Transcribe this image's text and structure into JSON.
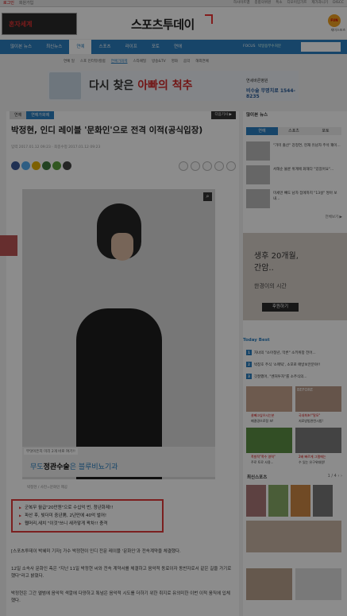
{
  "topbar": {
    "left": [
      "로그인",
      "회원가입"
    ],
    "right": [
      "하사이트맵",
      "종합의위원",
      "특소",
      "디모이임가프",
      "제가과니기",
      "DISCC"
    ]
  },
  "header": {
    "ad_left_text": "혼자세계",
    "logo": "스포츠투데이",
    "fun_badge": "FUN",
    "fun_label": "재미스포츠"
  },
  "nav": {
    "items": [
      "많이본 뉴스",
      "최신뉴스",
      "연예",
      "스포츠",
      "라이프",
      "포토",
      "연애"
    ],
    "active_index": 2,
    "focus": "FOCUS",
    "focus_text": "박일용부수처분"
  },
  "subnav": {
    "items": [
      "연예 일",
      "스포 인터뷰/칼럼",
      "연예가화제",
      "스타패밀",
      "방송&TV",
      "영화",
      "음악",
      "해외연예"
    ],
    "active_index": 2
  },
  "banner": {
    "title_a": "다시 찾은 ",
    "title_b": "아빠의 척추",
    "hospital": "연세바른병원",
    "phone": "비수술 무명치료 1544-8235"
  },
  "article": {
    "tabs": [
      "연예",
      "연예가화제"
    ],
    "more": "다음기사 ▶",
    "title": "박정현, 인디 레이블 '문화인'으로 전격 이적(공식입장)",
    "meta": "입력 2017.01.12 09:23  ·  최종수정 2017.01.12 09:23",
    "share_colors": [
      "#3b5998",
      "#55acee",
      "#e3b000",
      "#3e7b3e",
      "#5a9e3c",
      "#444"
    ],
    "photo_overlay_small": "무엇이든지 미리 2개 바로 여기!!",
    "photo_overlay_big_a": "무도",
    "photo_overlay_big_b": "정관수술",
    "photo_overlay_big_c": "은 블루비뇨기과",
    "caption": "박정현 / 사진=문화인 제공",
    "related": [
      "군복무 월급\"20만원\"으로 수십억 번, 청년화제!!",
      "파산 후, 빚더미 중년男, 2년만에 40억 벌어!",
      "휑머리,새치 \"이것\"쓰니 새카맣게 꽉차!! 충격"
    ],
    "paragraphs": [
      "[스포츠투데이 박혜미 기자] 가수 박정현이 인디 전문 레이블 '문화인'과 전속계약을 체결했다.",
      "12일 소속사 문화인 측은 \"지난 11일 박정현 씨와 전속 계약서를 체결하고 음악적 동료이자 동반자로서 같은 길을 가기로 했다\"라고 밝혔다.",
      "박정현은 그간 앨범에 음악적 색깔에 다양하고 톡넘은 음악적 시도를 더하기 위한 취지로 유의미한 이번 이적 움직에 입체했다."
    ]
  },
  "sidebar": {
    "head": "많이본 뉴스",
    "tabs": [
      "연예",
      "스포츠",
      "포토"
    ],
    "news": [
      "\"가미 출산\" 강정연, 현재 유남자 주석 쾌이...",
      "서해순 불륜 위계에 화해다 \"있었어요\"...",
      "미세먼 빼도 남자 집에까지 \"13설\" 쌍아 보내..."
    ],
    "more": "전체보기 ▶",
    "ad_l1": "생후 20개월,",
    "ad_l1b": "간암..",
    "ad_l2": "한경이의 시간",
    "ad_btn": "후원하기",
    "best_title": "Today Best",
    "best": [
      "자녀의 \"소아청년, 막론\" 소키위창 전어...",
      "박창호 주식 '소매틱', 소포로 애방보안분야!!",
      "갓잘했어, \"벤처투자\"를 소주식의..."
    ],
    "grid_caps": [
      "살빼고싶으시는분",
      "국내최초!\"탈모\"",
      "폭발적\"폭수 영력\"",
      "2배 빠르게 그램에는"
    ],
    "grid_caps2": [
      "폐결경으로정 보!",
      "지료방법관련시법!",
      "주로 토로 사용...",
      "수 있는 유구위대원!"
    ],
    "recent": "최신스포츠",
    "pager": "1 / 4  ‹ ›",
    "before": "BEFORE"
  }
}
